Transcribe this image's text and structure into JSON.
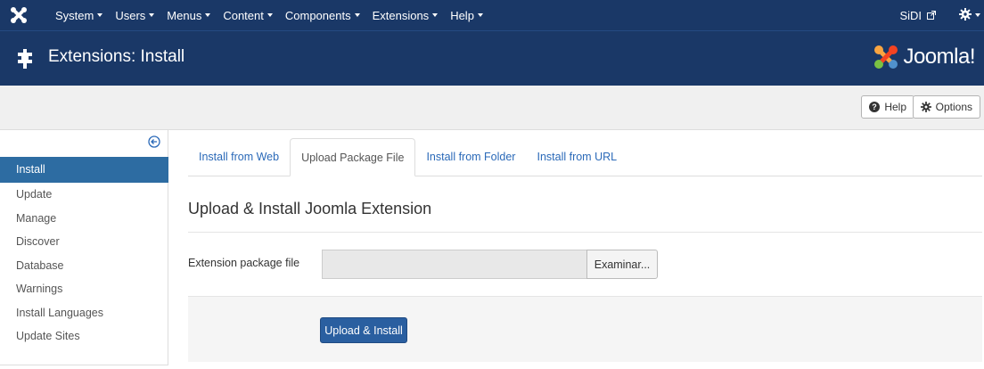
{
  "navbar": {
    "menus": [
      {
        "label": "System"
      },
      {
        "label": "Users"
      },
      {
        "label": "Menus"
      },
      {
        "label": "Content"
      },
      {
        "label": "Components"
      },
      {
        "label": "Extensions"
      },
      {
        "label": "Help"
      }
    ],
    "site_link": "SiDI",
    "brand_icon": "joomla-icon",
    "settings_icon": "gear-icon"
  },
  "header": {
    "title": "Extensions: Install",
    "icon": "puzzle-icon",
    "logo_text": "Joomla!"
  },
  "toolbar": {
    "help_label": "Help",
    "options_label": "Options"
  },
  "sidebar": {
    "items": [
      {
        "label": "Install",
        "active": true
      },
      {
        "label": "Update"
      },
      {
        "label": "Manage"
      },
      {
        "label": "Discover"
      },
      {
        "label": "Database"
      },
      {
        "label": "Warnings"
      },
      {
        "label": "Install Languages"
      },
      {
        "label": "Update Sites"
      }
    ]
  },
  "tabs": [
    {
      "label": "Install from Web"
    },
    {
      "label": "Upload Package File",
      "active": true
    },
    {
      "label": "Install from Folder"
    },
    {
      "label": "Install from URL"
    }
  ],
  "form": {
    "title": "Upload & Install Joomla Extension",
    "file_label": "Extension package file",
    "browse_label": "Examinar...",
    "submit_label": "Upload & Install"
  },
  "colors": {
    "navbar": "#1a3867",
    "active": "#2d6ca2",
    "primary_button": "#2a5fa0",
    "link": "#2a69b8"
  }
}
